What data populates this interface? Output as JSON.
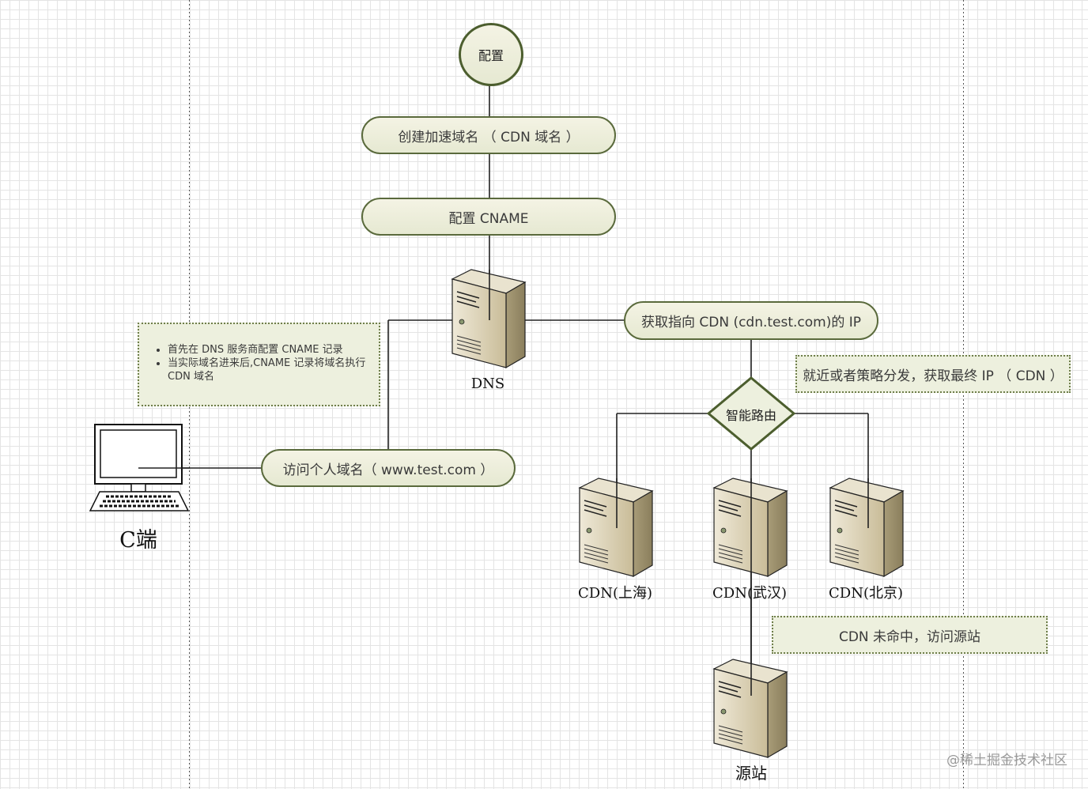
{
  "nodes": {
    "config": "配置",
    "create_domain": "创建加速域名 （ CDN 域名 ）",
    "config_cname": "配置 CNAME",
    "get_cdn_ip": "获取指向 CDN (cdn.test.com)的 IP",
    "visit_domain": "访问个人域名（ www.test.com ）",
    "smart_route": "智能路由"
  },
  "notes": {
    "dns_notes": [
      "首先在 DNS 服务商配置 CNAME  记录",
      "当实际域名进来后,CNAME 记录将域名执行 CDN 域名"
    ],
    "nearest_dispatch": "就近或者策略分发，获取最终 IP （ CDN ）",
    "cdn_miss": "CDN 未命中，访问源站"
  },
  "labels": {
    "dns": "DNS",
    "client": "C端",
    "cdn_shanghai": "CDN(上海)",
    "cdn_wuhan": "CDN(武汉)",
    "cdn_beijing": "CDN(北京)",
    "origin": "源站"
  },
  "watermark": "@稀土掘金技术社区",
  "colors": {
    "node_border": "#5a6a3c",
    "node_fill": "#eceedb",
    "server_body": "#d8ceb4",
    "connector": "#222222"
  },
  "icons": {
    "servers": [
      "server-icon"
    ],
    "client": "computer-icon"
  }
}
